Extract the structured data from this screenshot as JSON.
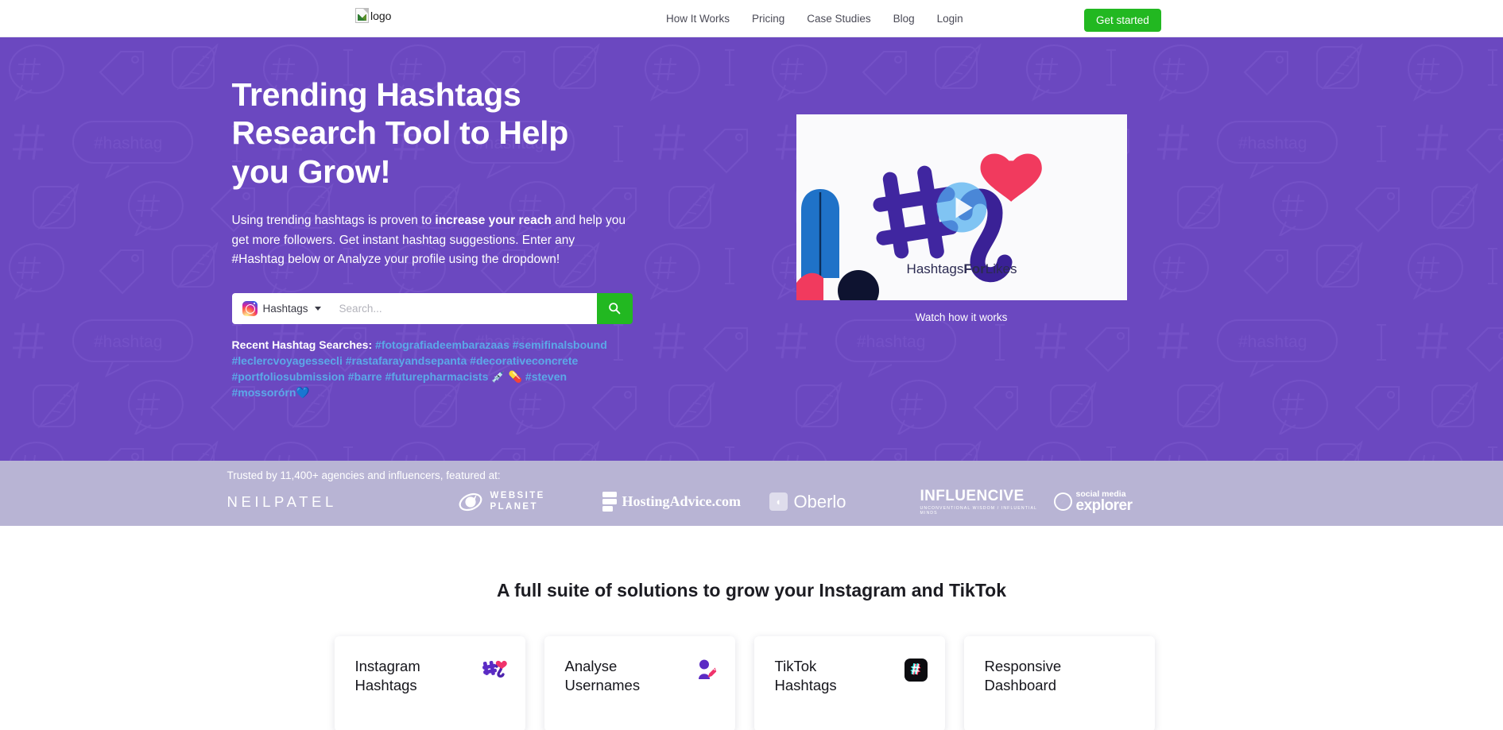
{
  "header": {
    "logo_alt": "logo",
    "nav": [
      {
        "label": "How It Works"
      },
      {
        "label": "Pricing"
      },
      {
        "label": "Case Studies"
      },
      {
        "label": "Blog"
      },
      {
        "label": "Login"
      }
    ],
    "cta_label": "Get started"
  },
  "hero": {
    "title": "Trending Hashtags\nResearch Tool to Help\nyou Grow!",
    "sub_part1": "Using trending hashtags is proven to ",
    "sub_bold": "increase your reach",
    "sub_part2": " and help you get more followers. Get instant hashtag suggestions. Enter any #Hashtag below or Analyze your profile using the dropdown!",
    "search": {
      "type_label": "Hashtags",
      "placeholder": "Search...",
      "value": "",
      "submit_icon": "search-icon"
    },
    "recent": {
      "label": "Recent Hashtag Searches:",
      "tags": [
        "#fotografiadeembarazaas",
        "#semifinalsbound",
        "#leclercvoyagessecli",
        "#rastafarayandsepanta",
        "#decorativeconcrete",
        "#portfoliosubmission",
        "#barre",
        "#futurepharmacists 💉 💊",
        "#steven",
        "#mossorórn💙"
      ]
    },
    "video": {
      "brand_light": "Hashtags",
      "brand_bold": "For",
      "brand_light2": "Likes",
      "caption": "Watch how it works",
      "play_icon": "play-icon"
    }
  },
  "trusted": {
    "text": "Trusted by 11,400+ agencies and influencers, featured at:",
    "brands": [
      {
        "name": "NEILPATEL"
      },
      {
        "name_line1": "WEBSITE",
        "name_line2": "PLANET"
      },
      {
        "name": "HostingAdvice.com"
      },
      {
        "name": "Oberlo"
      },
      {
        "name": "INFLUENCIVE",
        "tagline": "UNCONVENTIONAL WISDOM / INFLUENTIAL MINDS"
      },
      {
        "name_line1": "social media",
        "name_line2": "explorer"
      }
    ]
  },
  "solutions": {
    "title": "A full suite of solutions to grow your Instagram and TikTok",
    "cards": [
      {
        "title": "Instagram\nHashtags",
        "icon": "hashtag-heart-icon"
      },
      {
        "title": "Analyse\nUsernames",
        "icon": "person-pencil-icon"
      },
      {
        "title": "TikTok\nHashtags",
        "icon": "tiktok-hashtag-icon",
        "glyph": "#"
      },
      {
        "title": "Responsive\nDashboard",
        "icon": "none"
      }
    ]
  },
  "colors": {
    "hero_purple": "#6B48C0",
    "accent_green": "#22B821",
    "link_blue": "#5BA8E8",
    "trusted_lavender": "#B8B4D4"
  }
}
